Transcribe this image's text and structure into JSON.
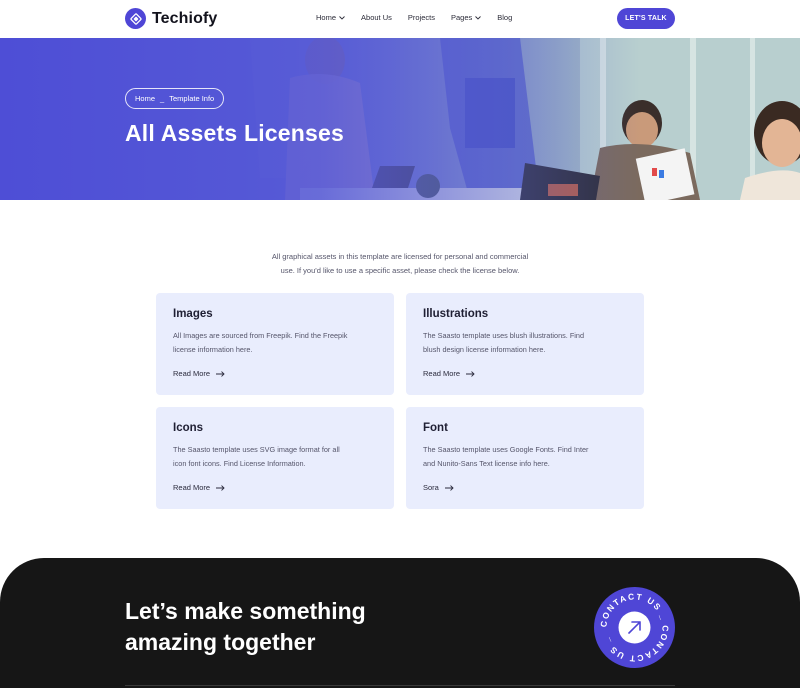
{
  "header": {
    "brand": "Techiofy",
    "nav": [
      {
        "label": "Home",
        "dropdown": true
      },
      {
        "label": "About Us",
        "dropdown": false
      },
      {
        "label": "Projects",
        "dropdown": false
      },
      {
        "label": "Pages",
        "dropdown": true
      },
      {
        "label": "Blog",
        "dropdown": false
      }
    ],
    "cta_label": "LET'S TALK"
  },
  "hero": {
    "breadcrumb_home": "Home",
    "breadcrumb_sep": "_",
    "breadcrumb_current": "Template Info",
    "title": "All Assets Licenses"
  },
  "intro": {
    "line1": "All graphical assets in this template are licensed for personal and commercial",
    "line2": "use. If you'd like to use a specific asset, please check the license below."
  },
  "cards": [
    {
      "title": "Images",
      "desc1": "All Images are sourced from Freepik. Find the Freepik",
      "desc2": "license information here.",
      "link": "Read More"
    },
    {
      "title": "Illustrations",
      "desc1": "The Saasto template uses blush illustrations. Find",
      "desc2": "blush design license information here.",
      "link": "Read More"
    },
    {
      "title": "Icons",
      "desc1": "The Saasto template uses SVG image format for all",
      "desc2": "icon font icons. Find License Information.",
      "link": "Read More"
    },
    {
      "title": "Font",
      "desc1": "The Saasto template uses Google Fonts. Find Inter",
      "desc2": "and Nunito-Sans Text license info here.",
      "link": "Sora"
    }
  ],
  "footer": {
    "title_line1": "Let’s make something",
    "title_line2": "amazing together",
    "badge_text": "CONTACT US _ CONTACT US _ ",
    "badge_icon": "arrow-up-right-icon"
  },
  "colors": {
    "accent": "#4f46d6",
    "card_bg": "#e9edfd",
    "footer_bg": "#161616"
  }
}
